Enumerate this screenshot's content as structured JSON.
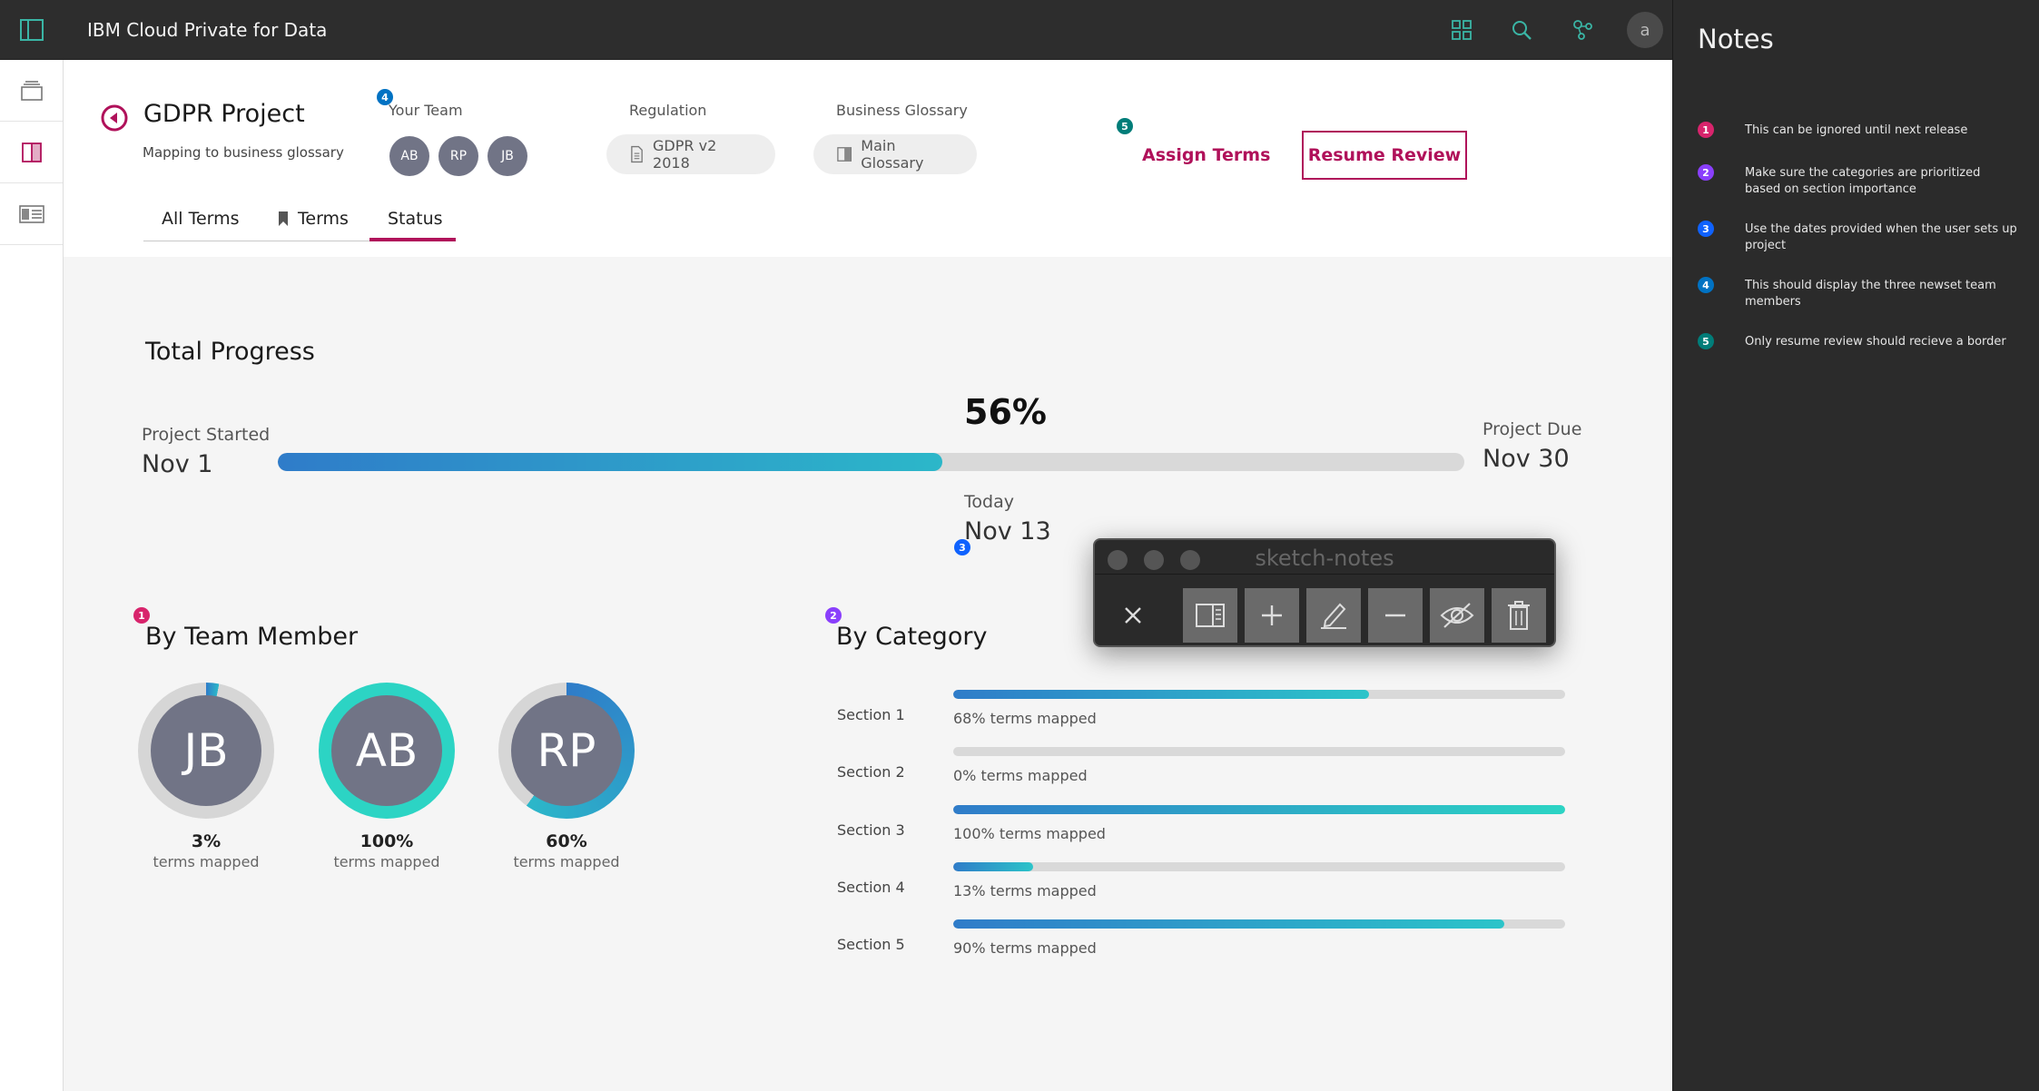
{
  "app": {
    "title": "IBM Cloud Private for Data",
    "avatar_initial": "a"
  },
  "project": {
    "title": "GDPR Project",
    "subtitle": "Mapping to business glossary",
    "team_label": "Your Team",
    "team": [
      "AB",
      "RP",
      "JB"
    ],
    "regulation_label": "Regulation",
    "regulation_value": "GDPR v2 2018",
    "glossary_label": "Business Glossary",
    "glossary_value": "Main Glossary",
    "assign_label": "Assign Terms",
    "resume_label": "Resume Review"
  },
  "tabs": [
    {
      "label": "All Terms"
    },
    {
      "label": "Terms"
    },
    {
      "label": "Status"
    }
  ],
  "active_tab": "Status",
  "progress": {
    "title": "Total Progress",
    "started_label": "Project Started",
    "started_date": "Nov 1",
    "due_label": "Project Due",
    "due_date": "Nov 30",
    "today_label": "Today",
    "today_date": "Nov 13",
    "percent_text": "56%",
    "percent": 56
  },
  "team_progress": {
    "title": "By Team Member",
    "members": [
      {
        "initials": "JB",
        "percent_text": "3%",
        "percent": 3,
        "sub": "terms mapped"
      },
      {
        "initials": "AB",
        "percent_text": "100%",
        "percent": 100,
        "sub": "terms mapped"
      },
      {
        "initials": "RP",
        "percent_text": "60%",
        "percent": 60,
        "sub": "terms mapped"
      }
    ]
  },
  "category_progress": {
    "title": "By Category",
    "sections": [
      {
        "name": "Section 1",
        "percent": 68,
        "text": "68% terms mapped"
      },
      {
        "name": "Section 2",
        "percent": 0,
        "text": "0% terms mapped"
      },
      {
        "name": "Section 3",
        "percent": 100,
        "text": "100% terms mapped"
      },
      {
        "name": "Section 4",
        "percent": 13,
        "text": "13% terms mapped"
      },
      {
        "name": "Section 5",
        "percent": 90,
        "text": "90% terms mapped"
      }
    ]
  },
  "badges": {
    "b1": "1",
    "b2": "2",
    "b3": "3",
    "b4": "4",
    "b5": "5"
  },
  "sketch": {
    "title": "sketch-notes"
  },
  "notes": {
    "title": "Notes",
    "items": [
      {
        "num": "1",
        "color": "#d8246c",
        "text": "This can be ignored until next release"
      },
      {
        "num": "2",
        "color": "#8a3ffc",
        "text": "Make sure the categories are prioritized based on section importance"
      },
      {
        "num": "3",
        "color": "#0f62fe",
        "text": "Use the dates provided when the user sets up project"
      },
      {
        "num": "4",
        "color": "#0072c3",
        "text": "This should display the three newset team members"
      },
      {
        "num": "5",
        "color": "#007d79",
        "text": "Only resume review should recieve a border"
      }
    ]
  },
  "colors": {
    "accent": "#b0115a",
    "progress_start": "#2f7cc9",
    "progress_end": "#2cd4c4",
    "avatar": "#717486"
  }
}
